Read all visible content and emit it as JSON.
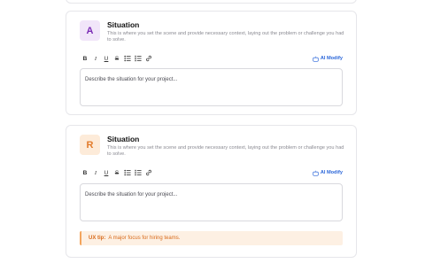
{
  "sections": [
    {
      "badge": "A",
      "title": "Situation",
      "description": "This is where you set the scene and provide necessary context, laying out the problem or challenge you had to solve.",
      "placeholder": "Describe the situation for your project...",
      "ai_label": "AI Modify"
    },
    {
      "badge": "R",
      "title": "Situation",
      "description": "This is where you set the scene and provide necessary context, laying out the problem or challenge you had to solve.",
      "placeholder": "Describe the situation for your project...",
      "ai_label": "AI Modify",
      "tip": {
        "label": "UX tip:",
        "text": "A major focus for hiring teams."
      }
    }
  ],
  "toolbar": {
    "bold": "B",
    "italic": "I",
    "underline": "U",
    "strike": "S"
  },
  "colors": {
    "badge_a_bg": "#f1e5f9",
    "badge_a_fg": "#7b2bb5",
    "badge_r_bg": "#fdebd9",
    "badge_r_fg": "#e27b2b",
    "ai_blue": "#2b66d9",
    "tip_orange": "#d86a1a"
  }
}
